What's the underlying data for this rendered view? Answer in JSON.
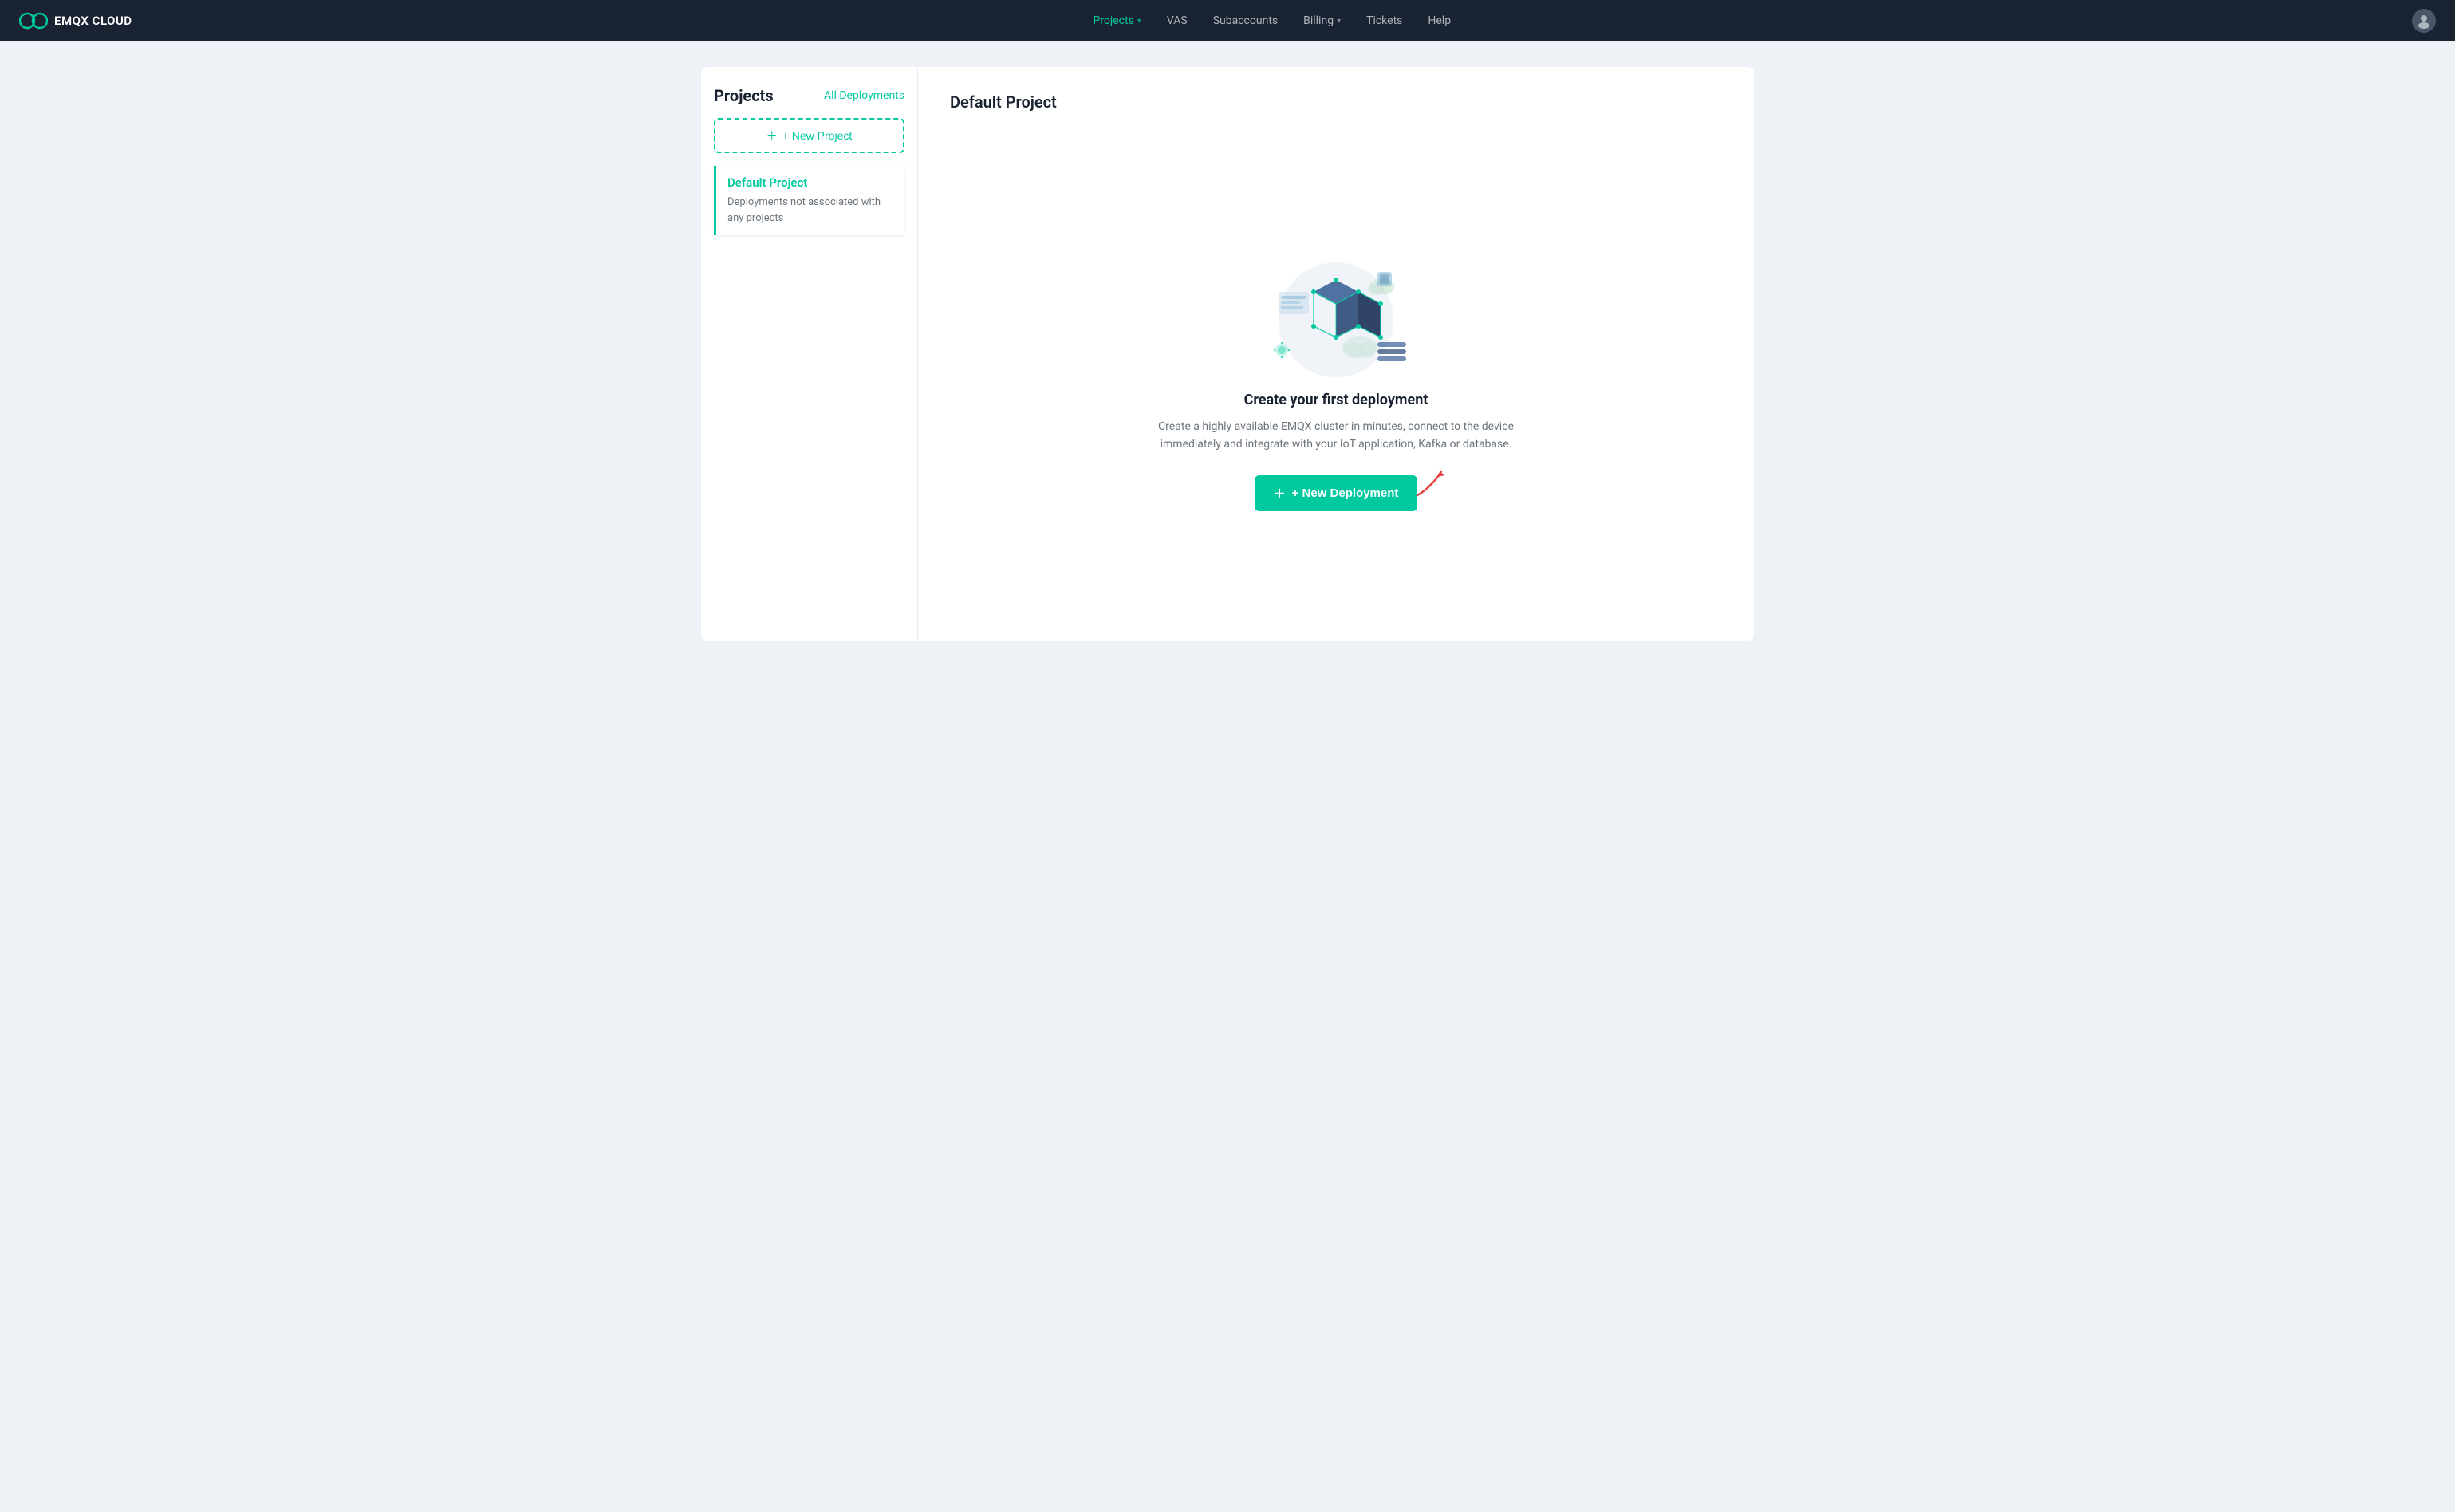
{
  "header": {
    "logo_text": "EMQX CLOUD",
    "nav": [
      {
        "label": "Projects",
        "active": true,
        "has_dropdown": true
      },
      {
        "label": "VAS",
        "active": false,
        "has_dropdown": false
      },
      {
        "label": "Subaccounts",
        "active": false,
        "has_dropdown": false
      },
      {
        "label": "Billing",
        "active": false,
        "has_dropdown": true
      },
      {
        "label": "Tickets",
        "active": false,
        "has_dropdown": false
      },
      {
        "label": "Help",
        "active": false,
        "has_dropdown": false
      }
    ]
  },
  "sidebar": {
    "title": "Projects",
    "all_deployments_label": "All Deployments",
    "new_project_label": "+ New Project",
    "projects": [
      {
        "name": "Default Project",
        "description": "Deployments not associated with any projects",
        "active": true
      }
    ]
  },
  "main": {
    "page_title": "Default Project",
    "empty_state": {
      "title": "Create your first deployment",
      "description": "Create a highly available EMQX cluster in minutes, connect to the device immediately and integrate with your IoT application, Kafka or database.",
      "new_deployment_label": "+ New Deployment"
    }
  },
  "colors": {
    "accent": "#00c9a0",
    "dark": "#1a2332",
    "nav_bg": "#1a2332",
    "arrow_color": "#e53e3e"
  }
}
